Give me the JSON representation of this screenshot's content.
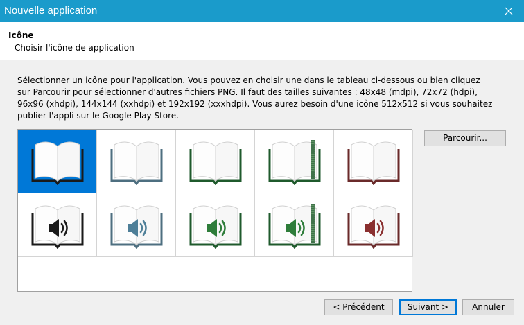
{
  "window": {
    "title": "Nouvelle application"
  },
  "header": {
    "title": "Icône",
    "subtitle": "Choisir l'icône de application"
  },
  "description": "Sélectionner un icône pour l'application. Vous pouvez en choisir une dans le tableau ci-dessous ou bien cliquez sur Parcourir pour sélectionner d'autres fichiers PNG. Il faut des tailles suivantes : 48x48 (mdpi), 72x72 (hdpi), 96x96 (xhdpi), 144x144 (xxhdpi) et 192x192 (xxxhdpi). Vous aurez besoin d'une icône 512x512 si vous souhaitez publier l'appli sur le Google Play Store.",
  "buttons": {
    "browse": "Parcourir...",
    "previous": "< Précédent",
    "next": "Suivant >",
    "cancel": "Annuler"
  },
  "icons": [
    {
      "name": "book-black-icon",
      "kind": "book",
      "color": "#1a1a1a",
      "selected": true
    },
    {
      "name": "book-slate-icon",
      "kind": "book",
      "color": "#4e6f80"
    },
    {
      "name": "book-green-icon",
      "kind": "book",
      "color": "#1f5a2c"
    },
    {
      "name": "book-green-bookmark-icon",
      "kind": "book",
      "color": "#1f5a2c",
      "bookmark": true
    },
    {
      "name": "book-maroon-icon",
      "kind": "book",
      "color": "#6a2a2a"
    },
    {
      "name": "audiobook-black-icon",
      "kind": "audio",
      "color": "#1a1a1a",
      "speaker": "#1a1a1a"
    },
    {
      "name": "audiobook-slate-icon",
      "kind": "audio",
      "color": "#4e6f80",
      "speaker": "#4e7f98"
    },
    {
      "name": "audiobook-green-icon",
      "kind": "audio",
      "color": "#1f5a2c",
      "speaker": "#2e7d3a"
    },
    {
      "name": "audiobook-green-bookmark-icon",
      "kind": "audio",
      "color": "#1f5a2c",
      "speaker": "#2e7d3a",
      "bookmark": true
    },
    {
      "name": "audiobook-maroon-icon",
      "kind": "audio",
      "color": "#6a2a2a",
      "speaker": "#8a2f2f"
    }
  ]
}
